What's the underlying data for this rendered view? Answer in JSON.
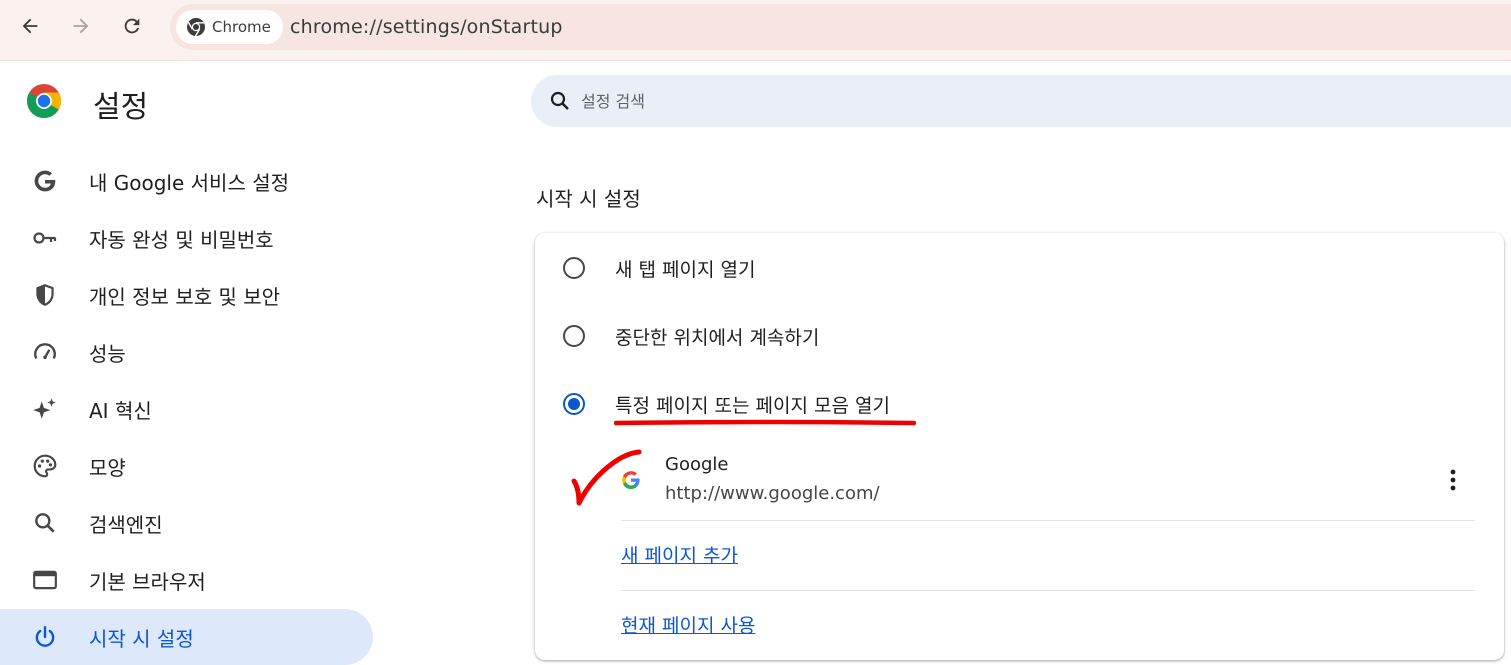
{
  "toolbar": {
    "back_icon": "arrow-left-icon",
    "forward_icon": "arrow-right-icon",
    "reload_icon": "reload-icon",
    "chip_label": "Chrome",
    "url": "chrome://settings/onStartup"
  },
  "sidebar": {
    "title": "설정",
    "items": [
      {
        "label": "내 Google 서비스 설정",
        "icon": "google-g-icon"
      },
      {
        "label": "자동 완성 및 비밀번호",
        "icon": "key-icon"
      },
      {
        "label": "개인 정보 보호 및 보안",
        "icon": "shield-icon"
      },
      {
        "label": "성능",
        "icon": "speedometer-icon"
      },
      {
        "label": "AI 혁신",
        "icon": "sparkle-icon"
      },
      {
        "label": "모양",
        "icon": "palette-icon"
      },
      {
        "label": "검색엔진",
        "icon": "search-icon"
      },
      {
        "label": "기본 브라우저",
        "icon": "browser-window-icon"
      },
      {
        "label": "시작 시 설정",
        "icon": "power-icon",
        "active": true
      }
    ]
  },
  "search": {
    "placeholder": "설정 검색"
  },
  "startup": {
    "title": "시작 시 설정",
    "options": [
      {
        "label": "새 탭 페이지 열기",
        "checked": false
      },
      {
        "label": "중단한 위치에서 계속하기",
        "checked": false
      },
      {
        "label": "특정 페이지 또는 페이지 모음 열기",
        "checked": true
      }
    ],
    "pages": [
      {
        "name": "Google",
        "url": "http://www.google.com/"
      }
    ],
    "add_page_label": "새 페이지 추가",
    "use_current_label": "현재 페이지 사용"
  },
  "colors": {
    "accent": "#0b57d0",
    "active_nav_bg": "#dde8fa",
    "annotation_red": "#ee0000"
  }
}
